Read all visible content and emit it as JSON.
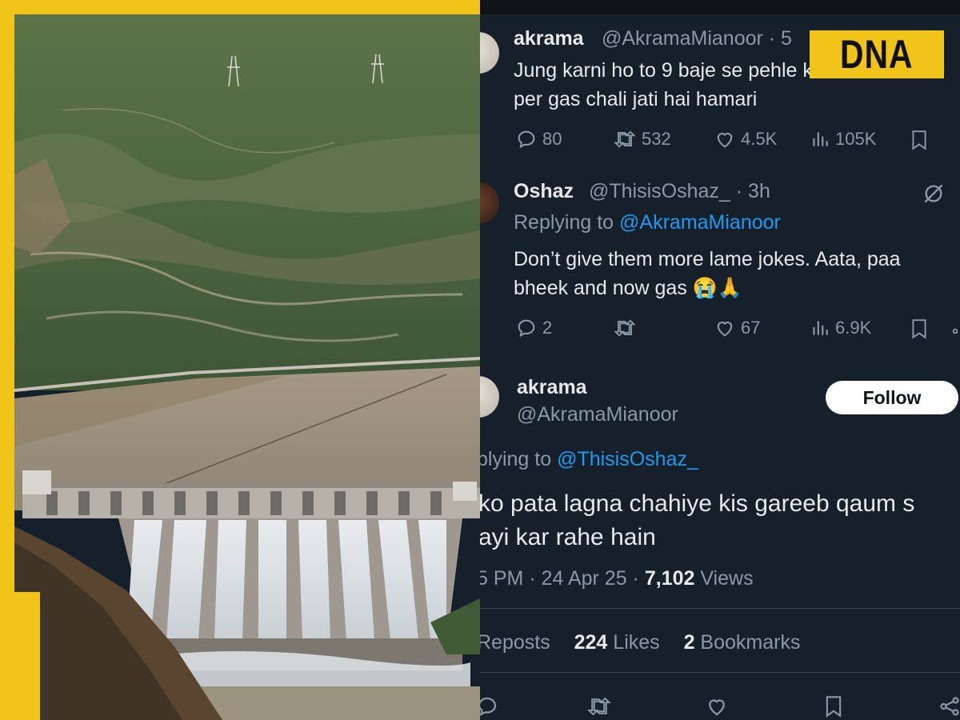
{
  "tweets": [
    {
      "name": "akrama",
      "handle": "@AkramaMianoor · 5",
      "text_lines": [
        "Jung karni ho to 9 baje se pehle karena 8:15",
        "per gas chali jati hai hamari"
      ],
      "replies": "80",
      "reposts": "532",
      "likes": "4.5K",
      "views": "105K"
    },
    {
      "name": "Oshaz",
      "handle": "@ThisisOshaz_ · 3h",
      "replying_prefix": "Replying to ",
      "replying_handle": "@AkramaMianoor",
      "text_lines": [
        "Don’t give them more lame jokes. Aata, paa",
        "bheek and now gas 😭🙏"
      ],
      "replies": "2",
      "reposts": "",
      "likes": "67",
      "views": "6.9K"
    }
  ],
  "main_tweet": {
    "name": "akrama",
    "handle": "@AkramaMianoor",
    "follow_label": "Follow",
    "replying_prefix": "plying to ",
    "replying_handle": "@ThisisOshaz_",
    "text_lines": [
      "ko pata lagna chahiye kis gareeb qaum s",
      "ayi kar rahe hain"
    ],
    "meta_time": "5 PM · 24 Apr 25 · ",
    "meta_views_count": "7,102",
    "meta_views_label": " Views",
    "reposts_label": "Reposts",
    "likes_count": "224",
    "likes_label": " Likes",
    "bookmarks_count": "2",
    "bookmarks_label": " Bookmarks"
  },
  "branding": {
    "logo_text": "DNA",
    "accent_color": "#f0c419"
  },
  "icons": [
    "reply-icon",
    "repost-icon",
    "like-icon",
    "views-icon",
    "bookmark-icon",
    "share-icon",
    "grok-icon"
  ],
  "colors": {
    "background": "#15202b",
    "text": "#e7e9ea",
    "secondary_text": "#8b98a5",
    "link": "#1d9bf0"
  }
}
